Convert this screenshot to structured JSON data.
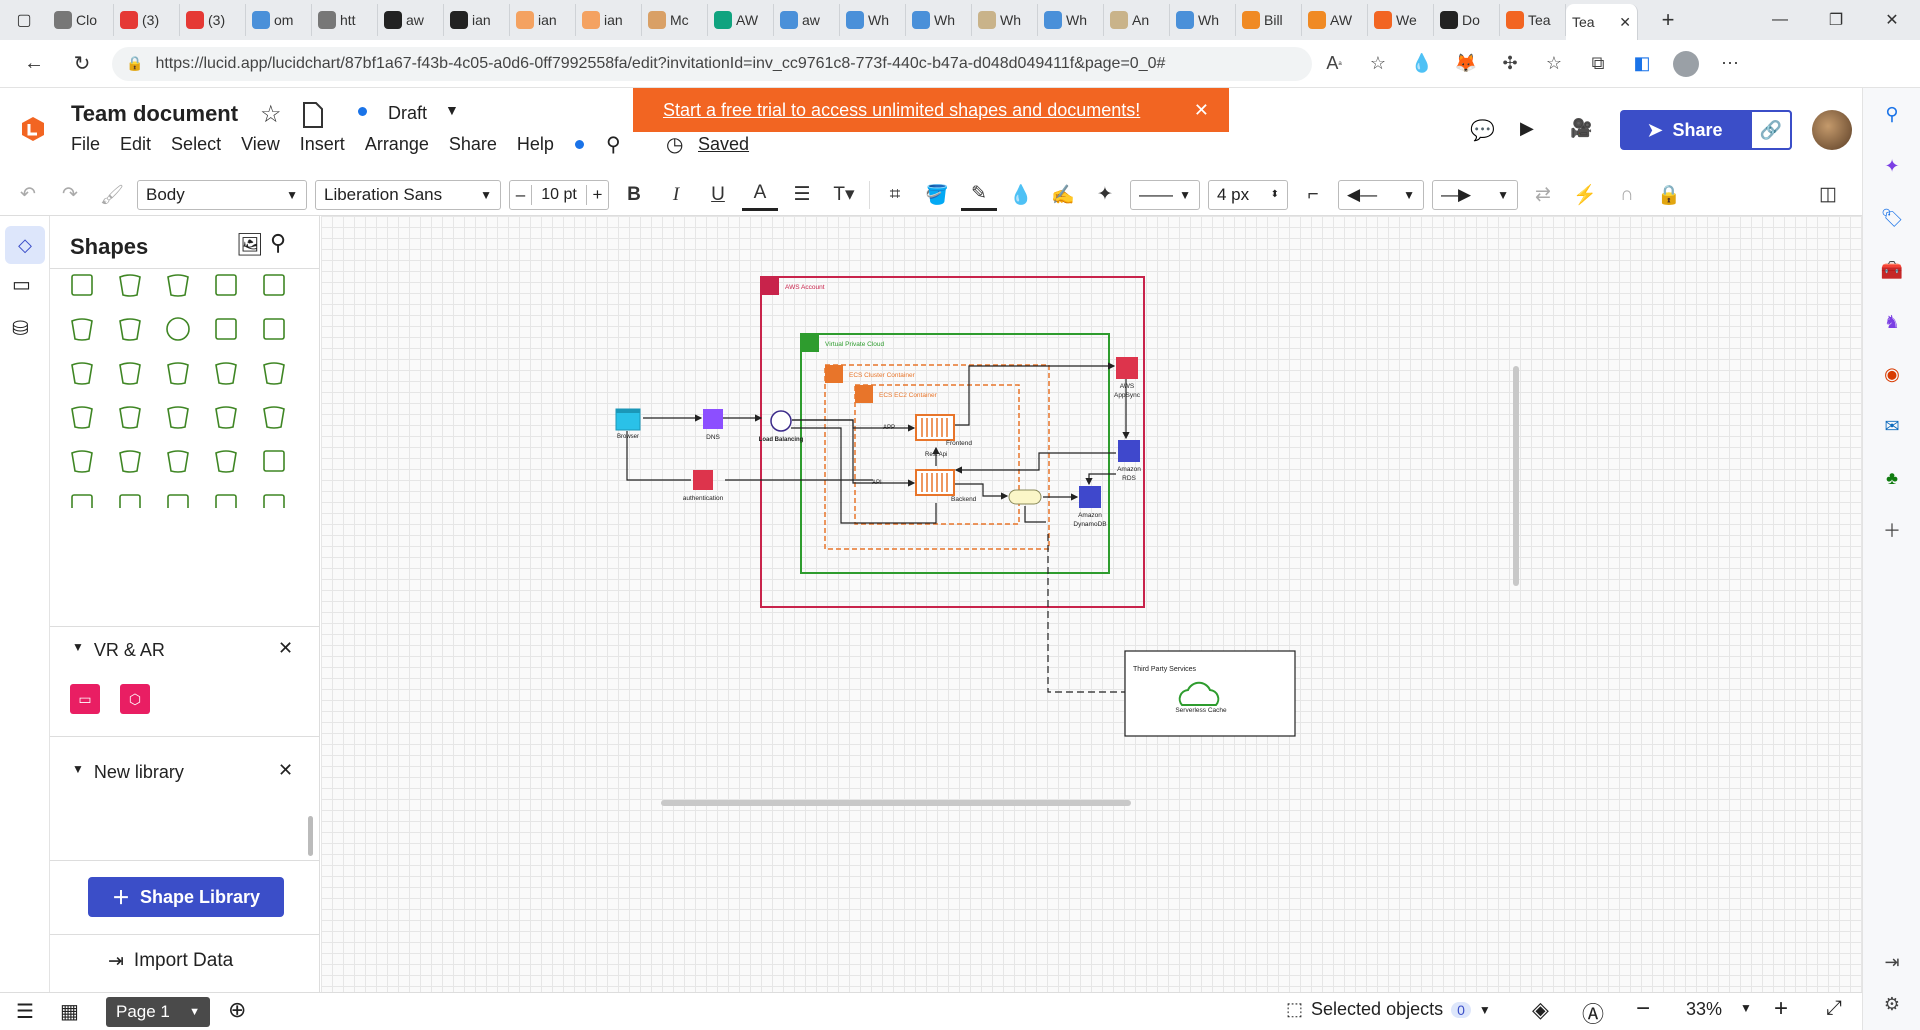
{
  "browser": {
    "tabs": [
      {
        "label": "Clo",
        "icon": "doc-icon",
        "color": "#777"
      },
      {
        "label": "(3)",
        "icon": "youtube-icon",
        "color": "#e53935"
      },
      {
        "label": "(3)",
        "icon": "youtube-icon",
        "color": "#e53935"
      },
      {
        "label": "om",
        "icon": "search-icon",
        "color": "#4a90d9"
      },
      {
        "label": "htt",
        "icon": "doc-icon",
        "color": "#777"
      },
      {
        "label": "aw",
        "icon": "github-icon",
        "color": "#222"
      },
      {
        "label": "ian",
        "icon": "github-icon",
        "color": "#222"
      },
      {
        "label": "ian",
        "icon": "g-icon",
        "color": "#f4a261"
      },
      {
        "label": "ian",
        "icon": "g-icon",
        "color": "#f4a261"
      },
      {
        "label": "Mc",
        "icon": "box-icon",
        "color": "#d9a066"
      },
      {
        "label": "AW",
        "icon": "chatgpt-icon",
        "color": "#10a37f"
      },
      {
        "label": "aw",
        "icon": "search-icon",
        "color": "#4a90d9"
      },
      {
        "label": "Wh",
        "icon": "search-icon",
        "color": "#4a90d9"
      },
      {
        "label": "Wh",
        "icon": "search-icon",
        "color": "#4a90d9"
      },
      {
        "label": "Wh",
        "icon": "docs-icon",
        "color": "#c9b38a"
      },
      {
        "label": "Wh",
        "icon": "search-icon",
        "color": "#4a90d9"
      },
      {
        "label": "An",
        "icon": "docs-icon",
        "color": "#c9b38a"
      },
      {
        "label": "Wh",
        "icon": "search-icon",
        "color": "#4a90d9"
      },
      {
        "label": "Bill",
        "icon": "aws-icon",
        "color": "#f08a24"
      },
      {
        "label": "AW",
        "icon": "aws-icon",
        "color": "#f08a24"
      },
      {
        "label": "We",
        "icon": "lucid-icon",
        "color": "#f26522"
      },
      {
        "label": "Do",
        "icon": "l-icon",
        "color": "#222"
      },
      {
        "label": "Tea",
        "icon": "lucid-icon",
        "color": "#f26522"
      },
      {
        "label": "Tea",
        "icon": "",
        "color": "#fff"
      }
    ],
    "url": "https://lucid.app/lucidchart/87bf1a67-f43b-4c05-a0d6-0ff7992558fa/edit?invitationId=inv_cc9761c8-773f-440c-b47a-d048d049411f&page=0_0#"
  },
  "app": {
    "title": "Team document",
    "status": "Draft",
    "saved": "Saved",
    "menu": [
      "File",
      "Edit",
      "Select",
      "View",
      "Insert",
      "Arrange",
      "Share",
      "Help"
    ],
    "banner": "Start a free trial to access unlimited shapes and documents!",
    "share_label": "Share",
    "accent": "#3b4ec8",
    "banner_color": "#f26522"
  },
  "toolbar": {
    "text_style": "Body",
    "font": "Liberation Sans",
    "font_size": "10 pt",
    "line_width": "4 px"
  },
  "panel": {
    "title": "Shapes",
    "vr_ar": "VR & AR",
    "new_library": "New library",
    "shape_library": "Shape Library",
    "import_data": "Import Data"
  },
  "bottom": {
    "page": "Page 1",
    "selected": "Selected objects",
    "selected_count": "0",
    "zoom": "33%"
  },
  "diagram": {
    "aws_account": "AWS Account",
    "vpc": "Virtual Private Cloud",
    "ecs_cluster": "ECS Cluster Container",
    "ecs_ec2": "ECS EC2 Container",
    "browser": "Browser",
    "dns": "DNS",
    "load_balancing": "Load Balancing",
    "authentication": "authentication",
    "frontend": "Frontend",
    "backend": "Backend",
    "rest_api": "Rest Api",
    "app": "APP",
    "api": "API",
    "appsync_1": "AWS",
    "appsync_2": "AppSync",
    "rds_1": "Amazon",
    "rds_2": "RDS",
    "dynamo_1": "Amazon",
    "dynamo_2": "DynamoDB",
    "third_party": "Third Party Services",
    "serverless": "Serverless Cache"
  }
}
